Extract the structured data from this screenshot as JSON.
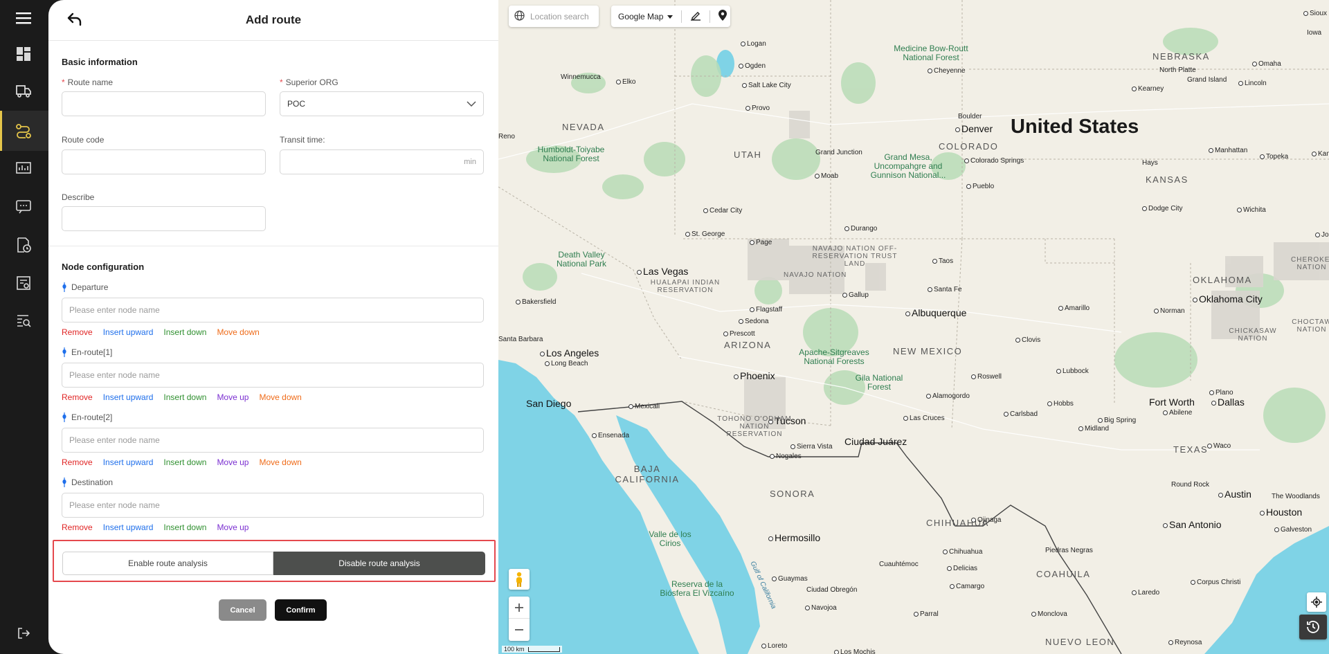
{
  "panel": {
    "title": "Add route",
    "basic_info_title": "Basic information",
    "route_name_label": "Route name",
    "superior_org_label": "Superior ORG",
    "superior_org_value": "POC",
    "route_code_label": "Route code",
    "transit_time_label": "Transit time:",
    "transit_time_unit": "min",
    "describe_label": "Describe",
    "node_config_title": "Node configuration",
    "node_placeholder": "Please enter node name",
    "nodes": [
      {
        "label": "Departure",
        "actions": [
          "Remove",
          "Insert upward",
          "Insert down",
          "Move down"
        ]
      },
      {
        "label": "En-route[1]",
        "actions": [
          "Remove",
          "Insert upward",
          "Insert down",
          "Move up",
          "Move down"
        ]
      },
      {
        "label": "En-route[2]",
        "actions": [
          "Remove",
          "Insert upward",
          "Insert down",
          "Move up",
          "Move down"
        ]
      },
      {
        "label": "Destination",
        "actions": [
          "Remove",
          "Insert upward",
          "Insert down",
          "Move up"
        ]
      }
    ],
    "enable_analysis": "Enable route analysis",
    "disable_analysis": "Disable route analysis",
    "cancel": "Cancel",
    "confirm": "Confirm"
  },
  "map": {
    "search_placeholder": "Location search",
    "map_type": "Google Map",
    "scale": "100 km",
    "country": "United States",
    "states": [
      "NEVADA",
      "UTAH",
      "COLORADO",
      "KANSAS",
      "NEBRASKA",
      "ARIZONA",
      "NEW MEXICO",
      "OKLAHOMA",
      "TEXAS",
      "BAJA CALIFORNIA",
      "SONORA",
      "CHIHUAHUA",
      "COAHUILA",
      "NUEVO LEON"
    ],
    "big_cities": [
      "Denver",
      "Las Vegas",
      "Los Angeles",
      "Phoenix",
      "Albuquerque",
      "Oklahoma City",
      "Tucson",
      "San Diego",
      "Ciudad Juárez",
      "Dallas",
      "Fort Worth",
      "Hermosillo",
      "Austin",
      "Houston",
      "San Antonio",
      "Salt Lake City"
    ],
    "cities": [
      "Logan",
      "Ogden",
      "Provo",
      "Winnemucca",
      "Elko",
      "Reno",
      "Cheyenne",
      "North Platte",
      "Omaha",
      "Kearney",
      "Grand Island",
      "Lincoln",
      "Sioux City",
      "Boulder",
      "Colorado Springs",
      "Pueblo",
      "Grand Junction",
      "Moab",
      "Cedar City",
      "St. George",
      "Durango",
      "Page",
      "Taos",
      "Santa Fe",
      "Gallup",
      "Flagstaff",
      "Sedona",
      "Prescott",
      "Hays",
      "Manhattan",
      "Topeka",
      "Kansas C",
      "Dodge City",
      "Wichita",
      "Joplin",
      "Bakersfield",
      "Santa Barbara",
      "Long Beach",
      "Mexicali",
      "Ensenada",
      "Nogales",
      "Sierra Vista",
      "Las Cruces",
      "Alamogordo",
      "Roswell",
      "Clovis",
      "Lubbock",
      "Amarillo",
      "Norman",
      "Hobbs",
      "Carlsbad",
      "Big Spring",
      "Midland",
      "Abilene",
      "Waco",
      "Plano",
      "Round Rock",
      "Ojinaga",
      "Chihuahua",
      "Delicias",
      "Camargo",
      "Cuauhtémoc",
      "Guaymas",
      "Ciudad Obregón",
      "Navojoa",
      "Parral",
      "Monclova",
      "Laredo",
      "Piedras Negras",
      "Corpus Christi",
      "Reynosa",
      "Galveston",
      "The Woodlands",
      "Los Mochis",
      "Loreto",
      "Iowa"
    ],
    "parks": [
      "Medicine Bow-Routt National Forest",
      "Humboldt-Toiyabe National Forest",
      "Grand Mesa, Uncompahgre and Gunnison National...",
      "Death Valley National Park",
      "Apache-Sitgreaves National Forests",
      "Gila National Forest"
    ],
    "reserves": [
      "NAVAJO NATION OFF-RESERVATION TRUST LAND",
      "NAVAJO NATION",
      "HUALAPAI INDIAN RESERVATION",
      "TOHONO O'ODHAM NATION RESERVATION",
      "CHEROKEE NATION",
      "CHICKASAW NATION",
      "CHOCTAW NATION"
    ],
    "water": [
      "Gulf of California",
      "Valle de los Cirios",
      "Reserva de la Biósfera El Vizcaíno"
    ]
  }
}
